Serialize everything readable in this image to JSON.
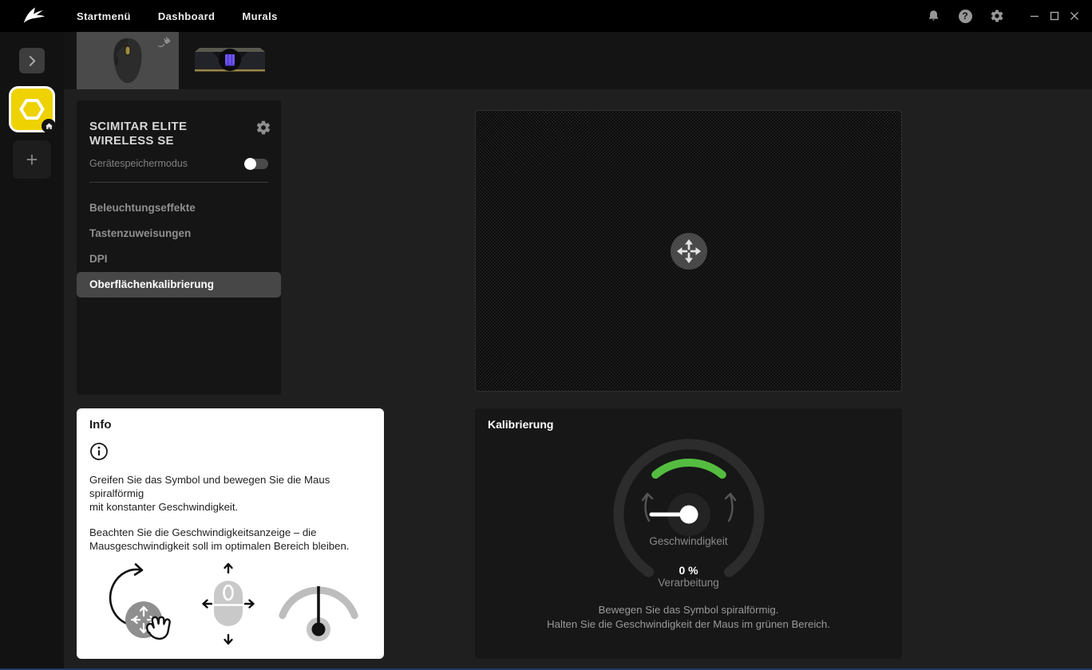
{
  "topbar": {
    "nav_items": [
      {
        "label": "Startmenü"
      },
      {
        "label": "Dashboard"
      },
      {
        "label": "Murals"
      }
    ],
    "icons": [
      "notifications-icon",
      "help-icon",
      "settings-icon"
    ],
    "window_controls": [
      "minimize",
      "maximize",
      "close"
    ]
  },
  "sidebar": {
    "items": [
      "expand-button",
      "yellow-hexagon-profile",
      "add-device-button"
    ]
  },
  "device_tabs": [
    {
      "name": "mouse",
      "selected": true,
      "connection": "wired-plug-icon"
    },
    {
      "name": "memory-module",
      "selected": false
    }
  ],
  "device_panel": {
    "title": "SCIMITAR ELITE\nWIRELESS SE",
    "memory_mode": {
      "label": "Gerätespeichermodus",
      "enabled": false
    },
    "menu": [
      {
        "label": "Beleuchtungseffekte",
        "selected": false
      },
      {
        "label": "Tastenzuweisungen",
        "selected": false
      },
      {
        "label": "DPI",
        "selected": false
      },
      {
        "label": "Oberflächenkalibrierung",
        "selected": true
      }
    ]
  },
  "info_panel": {
    "title": "Info",
    "paragraphs": [
      "Greifen Sie das Symbol und bewegen Sie die Maus spiralförmig\nmit konstanter Geschwindigkeit.",
      "Beachten Sie die Geschwindigkeitsanzeige – die\nMausgeschwindigkeit soll im optimalen Bereich bleiben."
    ],
    "illustrations": [
      "spiral-grab-icon",
      "mouse-directions-icon",
      "speed-gauge-icon"
    ]
  },
  "calibration": {
    "title": "Kalibrierung",
    "gauge_label": "Geschwindigkeit",
    "progress_value": "0 %",
    "progress_label": "Verarbeitung",
    "instructions": [
      "Bewegen Sie das Symbol spiralförmig.",
      "Halten Sie die Geschwindigkeit der Maus im grünen Bereich."
    ],
    "gauge": {
      "percent": 0,
      "green_zone_color": "#54bd40"
    }
  },
  "colors": {
    "accent_yellow": "#eed202",
    "green": "#54bd40",
    "ram_badge_purple": "#6f56f0"
  }
}
